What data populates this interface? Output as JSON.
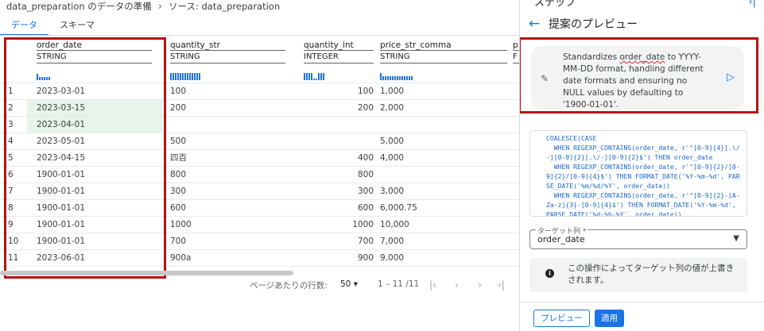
{
  "breadcrumb": {
    "part1": "data_preparation のデータの準備",
    "separator": "›",
    "part2": "ソース: data_preparation"
  },
  "tabs": [
    {
      "label": "データ",
      "active": true
    },
    {
      "label": "スキーマ",
      "active": false
    }
  ],
  "columns": [
    {
      "name": "order_date",
      "type": "STRING"
    },
    {
      "name": "quantity_str",
      "type": "STRING"
    },
    {
      "name": "quantity_int",
      "type": "INTEGER"
    },
    {
      "name": "price_str_comma",
      "type": "STRING"
    },
    {
      "name": "p",
      "type": "F"
    }
  ],
  "rows": [
    {
      "n": "1",
      "order_date": "2023-03-01",
      "quantity_str": "100",
      "quantity_int": "100",
      "price_str_comma": "1,000"
    },
    {
      "n": "2",
      "order_date": "2023-03-15",
      "quantity_str": "200",
      "quantity_int": "200",
      "price_str_comma": "2,000"
    },
    {
      "n": "3",
      "order_date": "2023-04-01",
      "quantity_str": "",
      "quantity_int": "",
      "price_str_comma": ""
    },
    {
      "n": "4",
      "order_date": "2023-05-01",
      "quantity_str": "500",
      "quantity_int": "",
      "price_str_comma": "5,000"
    },
    {
      "n": "5",
      "order_date": "2023-04-15",
      "quantity_str": "四百",
      "quantity_int": "400",
      "price_str_comma": "4,000"
    },
    {
      "n": "6",
      "order_date": "1900-01-01",
      "quantity_str": "800",
      "quantity_int": "800",
      "price_str_comma": ""
    },
    {
      "n": "7",
      "order_date": "1900-01-01",
      "quantity_str": "300",
      "quantity_int": "300",
      "price_str_comma": "3,000"
    },
    {
      "n": "8",
      "order_date": "1900-01-01",
      "quantity_str": "600",
      "quantity_int": "600",
      "price_str_comma": "6,000.75"
    },
    {
      "n": "9",
      "order_date": "1900-01-01",
      "quantity_str": "1000",
      "quantity_int": "1000",
      "price_str_comma": "10,000"
    },
    {
      "n": "10",
      "order_date": "1900-01-01",
      "quantity_str": "700",
      "quantity_int": "700",
      "price_str_comma": "7,000"
    },
    {
      "n": "11",
      "order_date": "2023-06-01",
      "quantity_str": "900a",
      "quantity_int": "900",
      "price_str_comma": "9,000"
    }
  ],
  "pager": {
    "rows_per_page_label": "ページあたりの行数:",
    "rows_per_page_value": "50",
    "range": "1 – 11 /11",
    "first": "|‹",
    "prev": "‹",
    "next": "›",
    "last": "›|"
  },
  "panel": {
    "top_label": "ステップ",
    "title": "提案のプレビュー",
    "suggestion_pre": "Standardizes ",
    "suggestion_word": "order_date",
    "suggestion_post": " to YYYY-MM-DD format, handling different date formats and ensuring no NULL values by defaulting to '1900-01-01'.",
    "code": "COALESCE(CASE\n  WHEN REGEXP_CONTAINS(order_date, r'^[0-9]{4}[.\\/-][0-9]{2}[.\\/-][0-9]{2}$') THEN order_date\n  WHEN REGEXP_CONTAINS(order_date, r'^[0-9]{2}/[0-9]{2}/[0-9]{4}$') THEN FORMAT_DATE('%Y-%m-%d', PARSE_DATE('%m/%d/%Y', order_date))\n  WHEN REGEXP_CONTAINS(order_date, r'^[0-9]{2}-[A-Za-z]{3}-[0-9]{4}$') THEN FORMAT_DATE('%Y-%m-%d', PARSE_DATE('%d-%b-%Y', order_date))\n  ELSE NULL",
    "target_label": "ターゲット列 *",
    "target_value": "order_date",
    "info_text": "この操作によってターゲット列の値が上書きされます。",
    "preview_button": "プレビュー",
    "apply_button": "適用"
  },
  "colors": {
    "accent": "#1a73e8",
    "highlight": "#e6f4ea",
    "annotation": "#b31412"
  }
}
